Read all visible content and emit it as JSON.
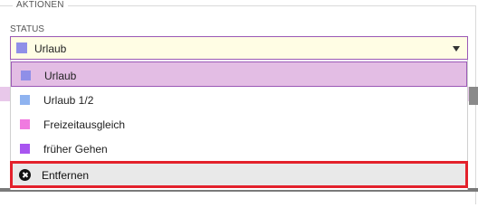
{
  "section": {
    "legend": "AKTIONEN"
  },
  "status": {
    "label": "STATUS",
    "selected": {
      "label": "Urlaub",
      "color": "#8f8fe8"
    }
  },
  "options": [
    {
      "label": "Urlaub",
      "color": "#8f8fe8",
      "selected": true
    },
    {
      "label": "Urlaub 1/2",
      "color": "#8fb3f0",
      "selected": false
    },
    {
      "label": "Freizeitausgleich",
      "color": "#f07ae0",
      "selected": false
    },
    {
      "label": "früher Gehen",
      "color": "#a855f0",
      "selected": false
    }
  ],
  "remove": {
    "label": "Entfernen",
    "icon": "close-circle-icon",
    "highlight": "#e3212b"
  }
}
